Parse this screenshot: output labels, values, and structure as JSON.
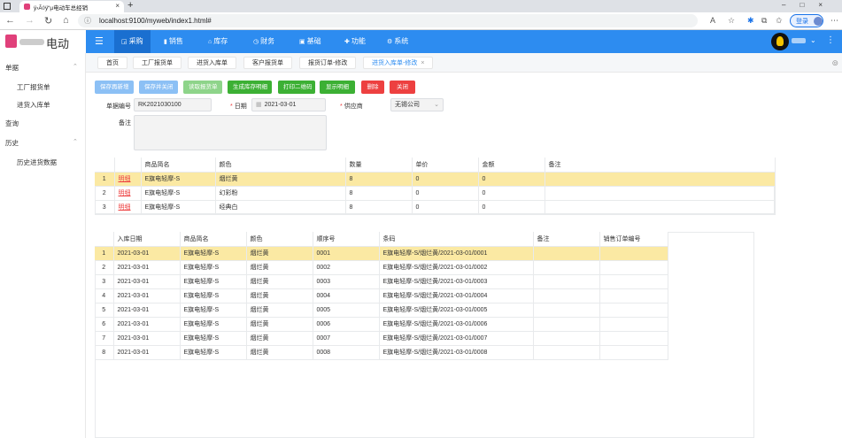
{
  "browser": {
    "tab_title": "ÿ›Ã◊ÿ“µ电动车总经销",
    "url": "localhost:9100/myweb/index1.html#",
    "login_label": "登录"
  },
  "app": {
    "brand": "电动",
    "top_menu": [
      {
        "label": "采购",
        "icon": "cart-icon",
        "active": true
      },
      {
        "label": "销售",
        "icon": "bar-icon",
        "active": false
      },
      {
        "label": "库存",
        "icon": "home-icon",
        "active": false
      },
      {
        "label": "财务",
        "icon": "clock-icon",
        "active": false
      },
      {
        "label": "基础",
        "icon": "box-icon",
        "active": false
      },
      {
        "label": "功能",
        "icon": "puzzle-icon",
        "active": false
      },
      {
        "label": "系统",
        "icon": "gear-icon",
        "active": false
      }
    ]
  },
  "sidebar": {
    "groups": [
      {
        "label": "单据",
        "expanded": true,
        "items": [
          "工厂报货单",
          "进货入库单"
        ]
      },
      {
        "label": "查询",
        "expanded": false,
        "items": []
      },
      {
        "label": "历史",
        "expanded": true,
        "items": [
          "历史进货数据"
        ]
      }
    ]
  },
  "page_tabs": [
    {
      "label": "首页",
      "active": false
    },
    {
      "label": "工厂报货单",
      "active": false
    },
    {
      "label": "进货入库单",
      "active": false
    },
    {
      "label": "客户报货单",
      "active": false
    },
    {
      "label": "报货订单-修改",
      "active": false
    },
    {
      "label": "进货入库单-修改",
      "active": true
    }
  ],
  "toolbar": [
    {
      "label": "保存再新增",
      "style": "b-blue-l"
    },
    {
      "label": "保存并关闭",
      "style": "b-blue-l"
    },
    {
      "label": "读取报货单",
      "style": "b-green-l"
    },
    {
      "label": "生成库存明细",
      "style": "b-green"
    },
    {
      "label": "打印二维码",
      "style": "b-green"
    },
    {
      "label": "显示明细",
      "style": "b-green"
    },
    {
      "label": "删除",
      "style": "b-red"
    },
    {
      "label": "关闭",
      "style": "b-red"
    }
  ],
  "form": {
    "doc_no_label": "单据编号",
    "doc_no": "RK2021030100",
    "date_label": "日期",
    "date": "2021-03-01",
    "supplier_label": "供应商",
    "supplier": "无锡公司",
    "note_label": "备注",
    "note": ""
  },
  "items_table": {
    "headers": [
      "",
      "",
      "商品简名",
      "颜色",
      "数量",
      "单价",
      "金额",
      "备注"
    ],
    "rows": [
      {
        "no": "1",
        "action": "明细",
        "name": "E旗电轻摩-S",
        "color": "烟烂黄",
        "qty": "8",
        "price": "0",
        "amount": "0",
        "note": "",
        "selected": true
      },
      {
        "no": "2",
        "action": "明细",
        "name": "E旗电轻摩-S",
        "color": "幻彩粉",
        "qty": "8",
        "price": "0",
        "amount": "0",
        "note": "",
        "selected": false
      },
      {
        "no": "3",
        "action": "明细",
        "name": "E旗电轻摩-S",
        "color": "经典白",
        "qty": "8",
        "price": "0",
        "amount": "0",
        "note": "",
        "selected": false
      }
    ]
  },
  "detail_table": {
    "headers": [
      "",
      "入库日期",
      "商品简名",
      "颜色",
      "顺序号",
      "条码",
      "备注",
      "销售订单编号"
    ],
    "rows": [
      {
        "no": "1",
        "date": "2021-03-01",
        "name": "E旗电轻摩-S",
        "color": "烟烂黄",
        "seq": "0001",
        "barcode": "E旗电轻摩-S/烟烂黄/2021-03-01/0001",
        "note": "",
        "order": "",
        "selected": true
      },
      {
        "no": "2",
        "date": "2021-03-01",
        "name": "E旗电轻摩-S",
        "color": "烟烂黄",
        "seq": "0002",
        "barcode": "E旗电轻摩-S/烟烂黄/2021-03-01/0002",
        "note": "",
        "order": "",
        "selected": false
      },
      {
        "no": "3",
        "date": "2021-03-01",
        "name": "E旗电轻摩-S",
        "color": "烟烂黄",
        "seq": "0003",
        "barcode": "E旗电轻摩-S/烟烂黄/2021-03-01/0003",
        "note": "",
        "order": "",
        "selected": false
      },
      {
        "no": "4",
        "date": "2021-03-01",
        "name": "E旗电轻摩-S",
        "color": "烟烂黄",
        "seq": "0004",
        "barcode": "E旗电轻摩-S/烟烂黄/2021-03-01/0004",
        "note": "",
        "order": "",
        "selected": false
      },
      {
        "no": "5",
        "date": "2021-03-01",
        "name": "E旗电轻摩-S",
        "color": "烟烂黄",
        "seq": "0005",
        "barcode": "E旗电轻摩-S/烟烂黄/2021-03-01/0005",
        "note": "",
        "order": "",
        "selected": false
      },
      {
        "no": "6",
        "date": "2021-03-01",
        "name": "E旗电轻摩-S",
        "color": "烟烂黄",
        "seq": "0006",
        "barcode": "E旗电轻摩-S/烟烂黄/2021-03-01/0006",
        "note": "",
        "order": "",
        "selected": false
      },
      {
        "no": "7",
        "date": "2021-03-01",
        "name": "E旗电轻摩-S",
        "color": "烟烂黄",
        "seq": "0007",
        "barcode": "E旗电轻摩-S/烟烂黄/2021-03-01/0007",
        "note": "",
        "order": "",
        "selected": false
      },
      {
        "no": "8",
        "date": "2021-03-01",
        "name": "E旗电轻摩-S",
        "color": "烟烂黄",
        "seq": "0008",
        "barcode": "E旗电轻摩-S/烟烂黄/2021-03-01/0008",
        "note": "",
        "order": "",
        "selected": false
      }
    ]
  },
  "colors": {
    "accent": "#2d8cf0",
    "selected_row": "#fbe9a3",
    "danger": "#ed4040",
    "success": "#3cb034"
  }
}
